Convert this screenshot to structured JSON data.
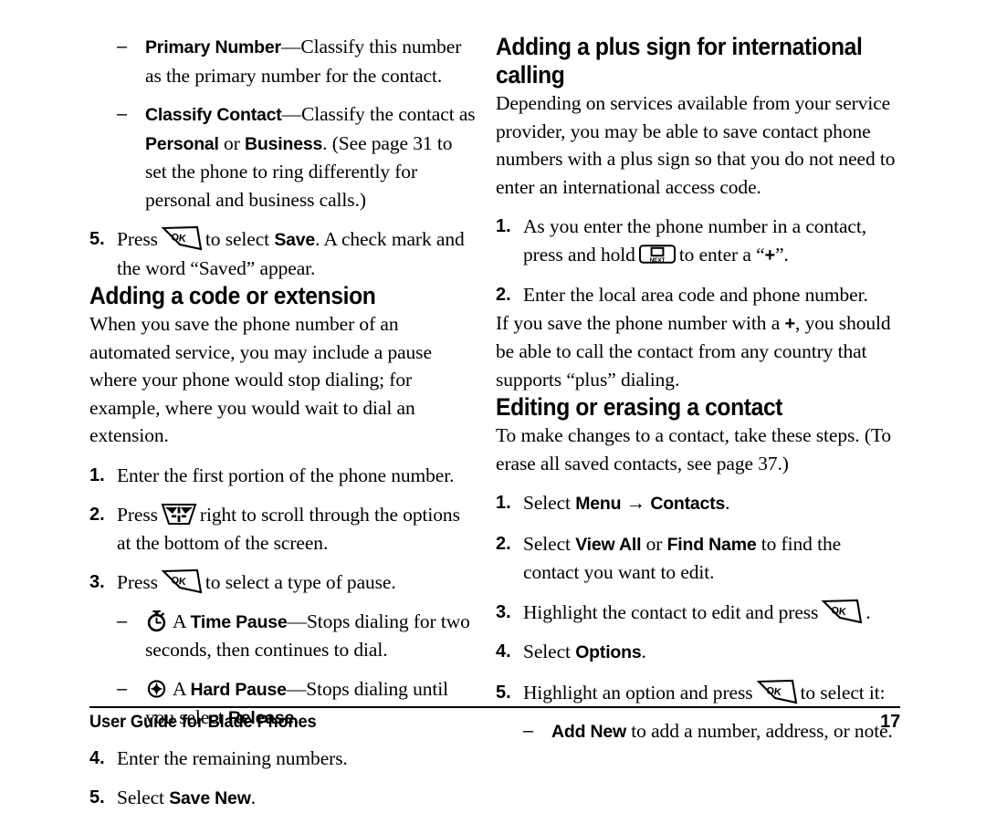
{
  "document": {
    "title": "User Guide for Blade Phones",
    "page_number": "17"
  },
  "icons": {
    "ok_key": "ok-key-icon",
    "nav_key": "navigation-key-icon",
    "next_key": "next-key-icon",
    "time_pause": "stopwatch-icon",
    "hard_pause": "star-burst-icon"
  },
  "left_column": {
    "continued_bullets": [
      {
        "dash": "–",
        "bold_lead": "Primary Number",
        "em_dash": "—",
        "text": "Classify this number as the primary number for the contact."
      },
      {
        "dash": "–",
        "bold_lead": "Classify Contact",
        "em_dash": "—",
        "text_part1": "Classify the contact as ",
        "bold_personal": "Personal",
        "text_or": " or ",
        "bold_business": "Business",
        "text_part2": ". (See page 31 to set the phone to ring differently for personal and business calls.)"
      }
    ],
    "step5_save": {
      "marker": "5.",
      "text_before": "Press",
      "text_middle": "to select ",
      "bold_save": "Save",
      "text_after": ". A check mark and the word “Saved” appear."
    },
    "heading_code_extension": "Adding a code or extension",
    "intro_paragraph": "When you save the phone number of an automated service, you may include a pause where your phone would stop dialing; for example, where you would wait to dial an extension.",
    "steps": [
      {
        "marker": "1.",
        "text": "Enter the first portion of the phone number."
      },
      {
        "marker": "2.",
        "text_before": "Press",
        "text_after": "right to scroll through the options at the bottom of the screen."
      },
      {
        "marker": "3.",
        "text_before": "Press",
        "text_after": "to select a type of pause."
      },
      {
        "marker": "4.",
        "text": "Enter the remaining numbers."
      },
      {
        "marker": "5.",
        "text_before": "Select ",
        "bold": "Save New",
        "text_after": "."
      }
    ],
    "pause_types": [
      {
        "dash": "–",
        "article": "A ",
        "bold_lead": "Time Pause",
        "em_dash": "—",
        "text": "Stops dialing for two seconds, then continues to dial."
      },
      {
        "dash": "–",
        "article": "A ",
        "bold_lead": "Hard Pause",
        "em_dash": "—",
        "text_part1": "Stops dialing until you select ",
        "bold_release": "Release",
        "text_part2": "."
      }
    ]
  },
  "right_column": {
    "heading_plus_sign": "Adding a plus sign for international calling",
    "intro_paragraph": "Depending on services available from your service provider, you may be able to save contact phone numbers with a plus sign so that you do not need to enter an international access code.",
    "steps": [
      {
        "marker": "1.",
        "text_before": "As you enter the phone number in a contact, press and hold",
        "text_after_a": "to enter a “",
        "plus": "+",
        "text_after_b": "”."
      },
      {
        "marker": "2.",
        "text": "Enter the local area code and phone number."
      }
    ],
    "closing_paragraph": {
      "part1": "If you save the phone number with a ",
      "plus": "+",
      "part2": ", you should be able to call the contact from any country that supports “plus” dialing."
    },
    "heading_editing": "Editing or erasing a contact",
    "editing_intro": "To make changes to a contact, take these steps. (To erase all saved contacts, see page 37.)",
    "editing_steps": [
      {
        "marker": "1.",
        "text_before": "Select ",
        "bold_menu": "Menu",
        "arrow": "→",
        "bold_contacts": "Contacts",
        "text_after": "."
      },
      {
        "marker": "2.",
        "text_before": "Select ",
        "bold_viewall": "View All",
        "text_or": " or ",
        "bold_findname": "Find Name",
        "text_after": " to find the contact you want to edit."
      },
      {
        "marker": "3.",
        "text_before": "Highlight the contact to edit and press",
        "text_after": "."
      },
      {
        "marker": "4.",
        "text_before": "Select ",
        "bold": "Options",
        "text_after": "."
      },
      {
        "marker": "5.",
        "text_before": "Highlight an option and press",
        "text_after": "to select it:"
      }
    ],
    "option_bullets": [
      {
        "dash": "–",
        "bold_lead": "Add New",
        "text": " to add a number, address, or note."
      }
    ]
  }
}
